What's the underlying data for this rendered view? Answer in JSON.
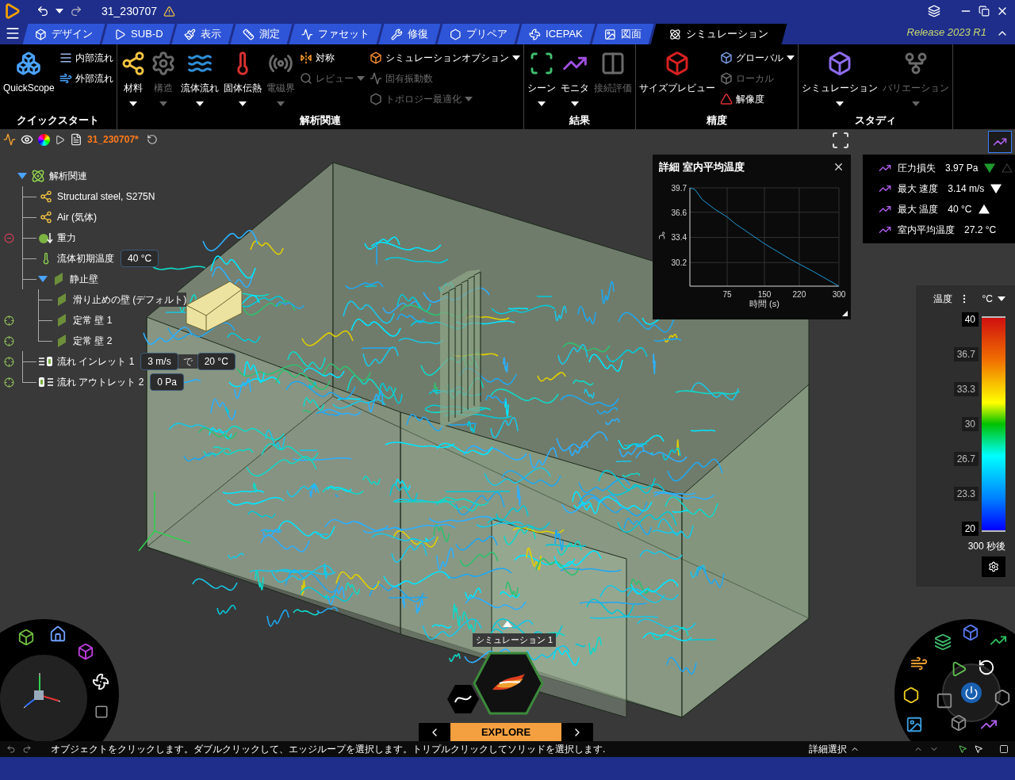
{
  "title_bar": {
    "title": "31_230707"
  },
  "tabs": [
    {
      "label": "デザイン",
      "selected": false
    },
    {
      "label": "SUB-D",
      "selected": false
    },
    {
      "label": "表示",
      "selected": false
    },
    {
      "label": "測定",
      "selected": false
    },
    {
      "label": "ファセット",
      "selected": false
    },
    {
      "label": "修復",
      "selected": false
    },
    {
      "label": "プリペア",
      "selected": false
    },
    {
      "label": "ICEPAK",
      "selected": false
    },
    {
      "label": "図面",
      "selected": false
    },
    {
      "label": "シミュレーション",
      "selected": true
    }
  ],
  "release": "Release 2023 R1",
  "ribbon": [
    {
      "title": "クイックスタート",
      "columns": [
        [
          {
            "label": "QuickScope",
            "disabled": false,
            "dropdown": false
          }
        ],
        [
          {
            "label": "内部流れ",
            "disabled": false,
            "dropdown": false
          },
          {
            "label": "外部流れ",
            "disabled": false,
            "dropdown": false
          }
        ]
      ]
    },
    {
      "title": "解析関連",
      "columns": [
        [
          {
            "label": "材料",
            "disabled": false,
            "dropdown": true
          }
        ],
        [
          {
            "label": "構造",
            "disabled": true,
            "dropdown": true
          }
        ],
        [
          {
            "label": "流体流れ",
            "disabled": false,
            "dropdown": true
          }
        ],
        [
          {
            "label": "固体伝熱",
            "disabled": false,
            "dropdown": true
          }
        ],
        [
          {
            "label": "電磁界",
            "disabled": true,
            "dropdown": true
          }
        ],
        [
          {
            "label": "対称",
            "disabled": false,
            "dropdown": false
          },
          {
            "label": "レビュー",
            "disabled": true,
            "dropdown": true
          }
        ],
        [
          {
            "label": "シミュレーションオプション",
            "disabled": false,
            "dropdown": true
          },
          {
            "label": "固有振動数",
            "disabled": true,
            "dropdown": false
          },
          {
            "label": "トポロジー最適化",
            "disabled": true,
            "dropdown": true
          }
        ]
      ]
    },
    {
      "title": "結果",
      "columns": [
        [
          {
            "label": "シーン",
            "disabled": false,
            "dropdown": true
          }
        ],
        [
          {
            "label": "モニタ",
            "disabled": false,
            "dropdown": true
          }
        ],
        [
          {
            "label": "接続評価",
            "disabled": true,
            "dropdown": false
          }
        ]
      ]
    },
    {
      "title": "精度",
      "columns": [
        [
          {
            "label": "サイズプレビュー",
            "disabled": false,
            "dropdown": false
          }
        ],
        [
          {
            "label": "グローバル",
            "disabled": false,
            "dropdown": true
          },
          {
            "label": "ローカル",
            "disabled": true,
            "dropdown": false
          },
          {
            "label": "解像度",
            "disabled": false,
            "dropdown": false
          }
        ]
      ]
    },
    {
      "title": "スタディ",
      "columns": [
        [
          {
            "label": "シミュレーション",
            "disabled": false,
            "dropdown": true
          }
        ],
        [
          {
            "label": "バリエーション",
            "disabled": true,
            "dropdown": true
          }
        ]
      ]
    }
  ],
  "tree": {
    "document": "31_230707*",
    "items": [
      {
        "label": "解析関連",
        "kind": "analysis",
        "expanded": true,
        "children": [
          {
            "label": "Structural steel, S275N",
            "kind": "material"
          },
          {
            "label": "Air (気体)",
            "kind": "material"
          },
          {
            "label": "重力",
            "kind": "gravity",
            "marker": {
              "kind": "remove"
            }
          },
          {
            "label": "流体初期温度",
            "kind": "temperature",
            "fields": [
              "40 °C"
            ]
          },
          {
            "label": "静止壁",
            "kind": "wall",
            "expanded": true,
            "children": [
              {
                "label": "滑り止めの壁 (デフォルト)",
                "kind": "wall"
              },
              {
                "label": "定常 壁 1",
                "kind": "wall",
                "marker": {
                  "kind": "target"
                }
              },
              {
                "label": "定常 壁 2",
                "kind": "wall",
                "marker": {
                  "kind": "target"
                }
              }
            ]
          },
          {
            "label": "流れ インレット 1",
            "kind": "inlet",
            "marker": {
              "kind": "target"
            },
            "fields": [
              "3 m/s",
              "20 °C"
            ],
            "joiner": "で"
          },
          {
            "label": "流れ アウトレット 2",
            "kind": "outlet",
            "marker": {
              "kind": "target"
            },
            "fields": [
              "0 Pa"
            ]
          }
        ]
      }
    ]
  },
  "chart_panel": {
    "title": "詳細 室内平均温度",
    "chart_data": {
      "type": "line",
      "grid": true,
      "xlabel": "時間 (s)",
      "ylabel": "℃",
      "xlim": [
        0,
        300
      ],
      "ylim": [
        27.2,
        39.7
      ],
      "xticks": [
        75,
        150,
        220,
        300
      ],
      "yticks": [
        39.7,
        36.6,
        33.4,
        30.2
      ],
      "x": [
        0,
        10,
        25,
        50,
        75,
        90,
        150,
        200,
        250,
        300
      ],
      "series": [
        {
          "color": "#1e9ad6",
          "values": [
            39.7,
            39.5,
            38.2,
            37.0,
            36.0,
            35.2,
            32.6,
            30.7,
            29.0,
            27.2
          ]
        }
      ]
    }
  },
  "monitors": [
    {
      "name": "圧力損失",
      "value": "3.97 Pa",
      "indicators": [
        {
          "kind": "down",
          "filled": true,
          "color": "#1f9a2e"
        },
        {
          "kind": "up",
          "filled": false,
          "color": "#3a3a3a"
        }
      ]
    },
    {
      "name": "最大 速度",
      "value": "3.14 m/s",
      "indicators": [
        {
          "kind": "down",
          "filled": true,
          "color": "#ffffff"
        }
      ]
    },
    {
      "name": "最大 温度",
      "value": "40 °C",
      "indicators": [
        {
          "kind": "up",
          "filled": true,
          "color": "#ffffff"
        }
      ]
    },
    {
      "name": "室内平均温度",
      "value": "27.2 °C"
    }
  ],
  "legend": {
    "title": "温度",
    "unit": "°C",
    "ticks": [
      "40",
      "36.7",
      "33.3",
      "30",
      "26.7",
      "23.3",
      "20"
    ],
    "time": "300 秒後"
  },
  "explore": {
    "study": "シミュレーション 1",
    "mode": "EXPLORE"
  },
  "status_bar": {
    "message": "オブジェクトをクリックします。ダブルクリックして、エッジループを選択します。トリプルクリックしてソリッドを選択します.",
    "selection": "詳細選択"
  }
}
